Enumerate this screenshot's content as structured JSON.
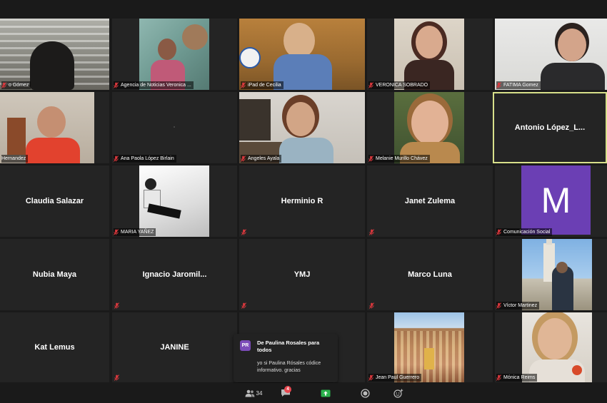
{
  "participants": {
    "r1c1": {
      "name": "o Gómez"
    },
    "r1c2": {
      "name": "Agencia de Noticias Veronica ..."
    },
    "r1c3": {
      "name": "iPad de Cecilia"
    },
    "r1c4": {
      "name": "VERONICA SOBRADO"
    },
    "r1c5": {
      "name": "FATIMA Gomez"
    },
    "r2c1": {
      "name": "Hernandez"
    },
    "r2c2": {
      "name": "Ana Paola López Birlain"
    },
    "r2c3": {
      "name": "Angeles Ayala"
    },
    "r2c4": {
      "name": "Melanie Murillo Chávez"
    },
    "r2c5": {
      "name": "Antonio  López_L..."
    },
    "r3c1": {
      "name": "Claudia Salazar"
    },
    "r3c2": {
      "name": "MARIA YAÑEZ"
    },
    "r3c3": {
      "name": "Herminio R"
    },
    "r3c4": {
      "name": "Janet Zulema"
    },
    "r3c5": {
      "name": "Comunicación Social",
      "avatar_letter": "M"
    },
    "r4c1": {
      "name": "Nubia Maya"
    },
    "r4c2": {
      "name": "Ignacio  Jaromil..."
    },
    "r4c3": {
      "name": "YMJ"
    },
    "r4c4": {
      "name": "Marco Luna"
    },
    "r4c5": {
      "name": "Víctor Martinez"
    },
    "r5c1": {
      "name": "Kat Lemus"
    },
    "r5c2": {
      "name": "JANINE"
    },
    "r5c4": {
      "name": "Jean Paul Guerrero"
    },
    "r5c5": {
      "name": "Mónica Reims"
    }
  },
  "chat_popup": {
    "initials": "PR",
    "title": "De Paulina Rosales para todos",
    "message": "yo si Paulina Rósales códice informativo. gracias"
  },
  "toolbar": {
    "participants_count": "34",
    "chat_badge": "4"
  },
  "colors": {
    "background": "#1a1a1a",
    "tile": "#242424",
    "active_speaker_border": "#d8e08a",
    "avatar_purple": "#6b3fb4",
    "mute_red": "#e0393e",
    "share_green": "#2bb24c"
  }
}
